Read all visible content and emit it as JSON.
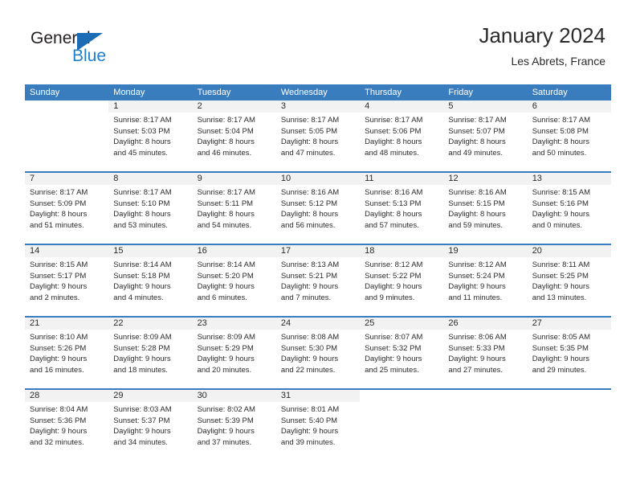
{
  "brand": {
    "name_part1": "General",
    "name_part2": "Blue"
  },
  "header": {
    "title": "January 2024",
    "subtitle": "Les Abrets, France"
  },
  "colors": {
    "header_blue": "#3a7dbe",
    "daynum_band": "#f2f2f2",
    "text": "#2b2b2b",
    "logo_blue": "#1f7fd0"
  },
  "weekdays": [
    "Sunday",
    "Monday",
    "Tuesday",
    "Wednesday",
    "Thursday",
    "Friday",
    "Saturday"
  ],
  "weeks": [
    [
      {
        "day": "",
        "sunrise": "",
        "sunset": "",
        "daylight1": "",
        "daylight2": ""
      },
      {
        "day": "1",
        "sunrise": "Sunrise: 8:17 AM",
        "sunset": "Sunset: 5:03 PM",
        "daylight1": "Daylight: 8 hours",
        "daylight2": "and 45 minutes."
      },
      {
        "day": "2",
        "sunrise": "Sunrise: 8:17 AM",
        "sunset": "Sunset: 5:04 PM",
        "daylight1": "Daylight: 8 hours",
        "daylight2": "and 46 minutes."
      },
      {
        "day": "3",
        "sunrise": "Sunrise: 8:17 AM",
        "sunset": "Sunset: 5:05 PM",
        "daylight1": "Daylight: 8 hours",
        "daylight2": "and 47 minutes."
      },
      {
        "day": "4",
        "sunrise": "Sunrise: 8:17 AM",
        "sunset": "Sunset: 5:06 PM",
        "daylight1": "Daylight: 8 hours",
        "daylight2": "and 48 minutes."
      },
      {
        "day": "5",
        "sunrise": "Sunrise: 8:17 AM",
        "sunset": "Sunset: 5:07 PM",
        "daylight1": "Daylight: 8 hours",
        "daylight2": "and 49 minutes."
      },
      {
        "day": "6",
        "sunrise": "Sunrise: 8:17 AM",
        "sunset": "Sunset: 5:08 PM",
        "daylight1": "Daylight: 8 hours",
        "daylight2": "and 50 minutes."
      }
    ],
    [
      {
        "day": "7",
        "sunrise": "Sunrise: 8:17 AM",
        "sunset": "Sunset: 5:09 PM",
        "daylight1": "Daylight: 8 hours",
        "daylight2": "and 51 minutes."
      },
      {
        "day": "8",
        "sunrise": "Sunrise: 8:17 AM",
        "sunset": "Sunset: 5:10 PM",
        "daylight1": "Daylight: 8 hours",
        "daylight2": "and 53 minutes."
      },
      {
        "day": "9",
        "sunrise": "Sunrise: 8:17 AM",
        "sunset": "Sunset: 5:11 PM",
        "daylight1": "Daylight: 8 hours",
        "daylight2": "and 54 minutes."
      },
      {
        "day": "10",
        "sunrise": "Sunrise: 8:16 AM",
        "sunset": "Sunset: 5:12 PM",
        "daylight1": "Daylight: 8 hours",
        "daylight2": "and 56 minutes."
      },
      {
        "day": "11",
        "sunrise": "Sunrise: 8:16 AM",
        "sunset": "Sunset: 5:13 PM",
        "daylight1": "Daylight: 8 hours",
        "daylight2": "and 57 minutes."
      },
      {
        "day": "12",
        "sunrise": "Sunrise: 8:16 AM",
        "sunset": "Sunset: 5:15 PM",
        "daylight1": "Daylight: 8 hours",
        "daylight2": "and 59 minutes."
      },
      {
        "day": "13",
        "sunrise": "Sunrise: 8:15 AM",
        "sunset": "Sunset: 5:16 PM",
        "daylight1": "Daylight: 9 hours",
        "daylight2": "and 0 minutes."
      }
    ],
    [
      {
        "day": "14",
        "sunrise": "Sunrise: 8:15 AM",
        "sunset": "Sunset: 5:17 PM",
        "daylight1": "Daylight: 9 hours",
        "daylight2": "and 2 minutes."
      },
      {
        "day": "15",
        "sunrise": "Sunrise: 8:14 AM",
        "sunset": "Sunset: 5:18 PM",
        "daylight1": "Daylight: 9 hours",
        "daylight2": "and 4 minutes."
      },
      {
        "day": "16",
        "sunrise": "Sunrise: 8:14 AM",
        "sunset": "Sunset: 5:20 PM",
        "daylight1": "Daylight: 9 hours",
        "daylight2": "and 6 minutes."
      },
      {
        "day": "17",
        "sunrise": "Sunrise: 8:13 AM",
        "sunset": "Sunset: 5:21 PM",
        "daylight1": "Daylight: 9 hours",
        "daylight2": "and 7 minutes."
      },
      {
        "day": "18",
        "sunrise": "Sunrise: 8:12 AM",
        "sunset": "Sunset: 5:22 PM",
        "daylight1": "Daylight: 9 hours",
        "daylight2": "and 9 minutes."
      },
      {
        "day": "19",
        "sunrise": "Sunrise: 8:12 AM",
        "sunset": "Sunset: 5:24 PM",
        "daylight1": "Daylight: 9 hours",
        "daylight2": "and 11 minutes."
      },
      {
        "day": "20",
        "sunrise": "Sunrise: 8:11 AM",
        "sunset": "Sunset: 5:25 PM",
        "daylight1": "Daylight: 9 hours",
        "daylight2": "and 13 minutes."
      }
    ],
    [
      {
        "day": "21",
        "sunrise": "Sunrise: 8:10 AM",
        "sunset": "Sunset: 5:26 PM",
        "daylight1": "Daylight: 9 hours",
        "daylight2": "and 16 minutes."
      },
      {
        "day": "22",
        "sunrise": "Sunrise: 8:09 AM",
        "sunset": "Sunset: 5:28 PM",
        "daylight1": "Daylight: 9 hours",
        "daylight2": "and 18 minutes."
      },
      {
        "day": "23",
        "sunrise": "Sunrise: 8:09 AM",
        "sunset": "Sunset: 5:29 PM",
        "daylight1": "Daylight: 9 hours",
        "daylight2": "and 20 minutes."
      },
      {
        "day": "24",
        "sunrise": "Sunrise: 8:08 AM",
        "sunset": "Sunset: 5:30 PM",
        "daylight1": "Daylight: 9 hours",
        "daylight2": "and 22 minutes."
      },
      {
        "day": "25",
        "sunrise": "Sunrise: 8:07 AM",
        "sunset": "Sunset: 5:32 PM",
        "daylight1": "Daylight: 9 hours",
        "daylight2": "and 25 minutes."
      },
      {
        "day": "26",
        "sunrise": "Sunrise: 8:06 AM",
        "sunset": "Sunset: 5:33 PM",
        "daylight1": "Daylight: 9 hours",
        "daylight2": "and 27 minutes."
      },
      {
        "day": "27",
        "sunrise": "Sunrise: 8:05 AM",
        "sunset": "Sunset: 5:35 PM",
        "daylight1": "Daylight: 9 hours",
        "daylight2": "and 29 minutes."
      }
    ],
    [
      {
        "day": "28",
        "sunrise": "Sunrise: 8:04 AM",
        "sunset": "Sunset: 5:36 PM",
        "daylight1": "Daylight: 9 hours",
        "daylight2": "and 32 minutes."
      },
      {
        "day": "29",
        "sunrise": "Sunrise: 8:03 AM",
        "sunset": "Sunset: 5:37 PM",
        "daylight1": "Daylight: 9 hours",
        "daylight2": "and 34 minutes."
      },
      {
        "day": "30",
        "sunrise": "Sunrise: 8:02 AM",
        "sunset": "Sunset: 5:39 PM",
        "daylight1": "Daylight: 9 hours",
        "daylight2": "and 37 minutes."
      },
      {
        "day": "31",
        "sunrise": "Sunrise: 8:01 AM",
        "sunset": "Sunset: 5:40 PM",
        "daylight1": "Daylight: 9 hours",
        "daylight2": "and 39 minutes."
      },
      {
        "day": "",
        "sunrise": "",
        "sunset": "",
        "daylight1": "",
        "daylight2": ""
      },
      {
        "day": "",
        "sunrise": "",
        "sunset": "",
        "daylight1": "",
        "daylight2": ""
      },
      {
        "day": "",
        "sunrise": "",
        "sunset": "",
        "daylight1": "",
        "daylight2": ""
      }
    ]
  ]
}
